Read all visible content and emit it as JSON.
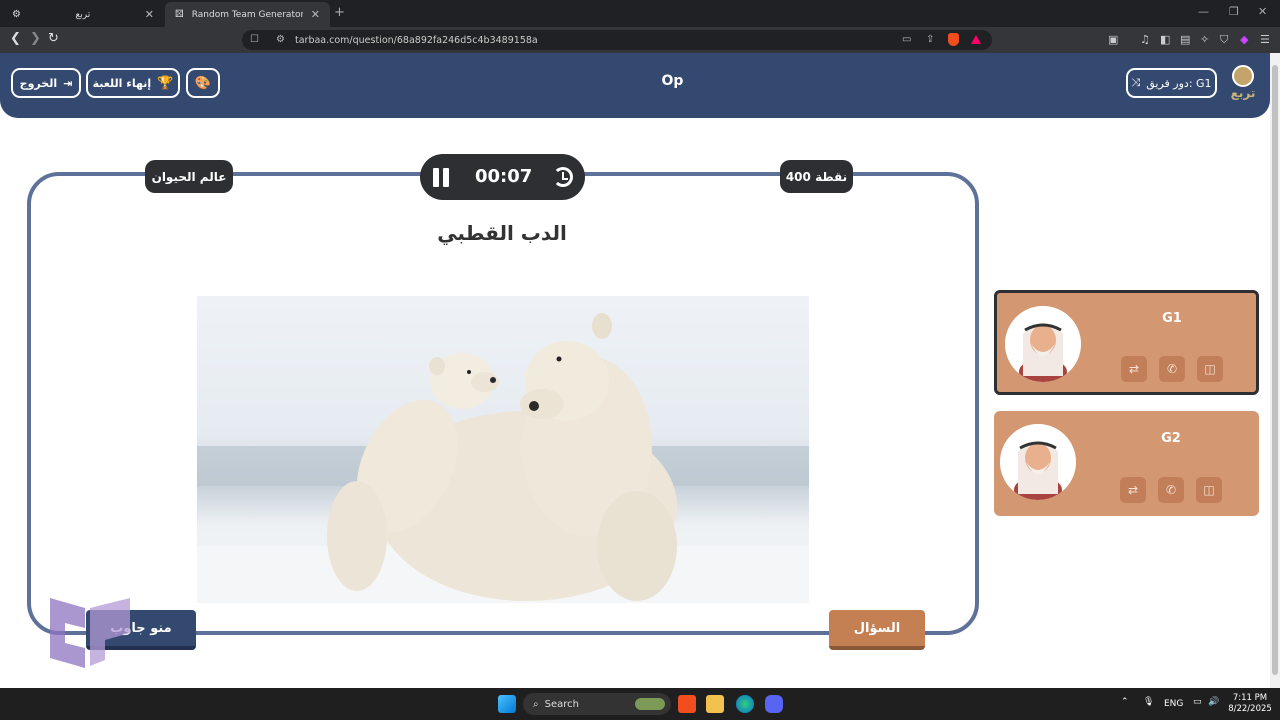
{
  "browser": {
    "tabs": [
      {
        "title": "تربع",
        "active": false
      },
      {
        "title": "Random Team Generator — Split a li",
        "active": true
      }
    ],
    "url": "tarbaa.com/question/68a892fa246d5c4b3489158a"
  },
  "header": {
    "exit_label": "الخروج",
    "end_game_label": "إنهاء اللعبة",
    "game_title": "Op",
    "turn_label": "دور فريق: G1",
    "logo_text": "تربع"
  },
  "question": {
    "category": "عالم الحيوان",
    "points": "400 نقطة",
    "timer": "00:07",
    "answer_title": "الدب القطبي",
    "question_button": "السؤال",
    "who_answered_button": "منو جاوب"
  },
  "teams": [
    {
      "name": "G1",
      "active": true
    },
    {
      "name": "G2",
      "active": false
    }
  ],
  "taskbar": {
    "search_placeholder": "Search",
    "language": "ENG",
    "time": "7:11 PM",
    "date": "8/22/2025"
  },
  "colors": {
    "header_navy": "#33496f",
    "card_border": "#5e7299",
    "team_card": "#d39872",
    "question_button": "#c47f52"
  }
}
